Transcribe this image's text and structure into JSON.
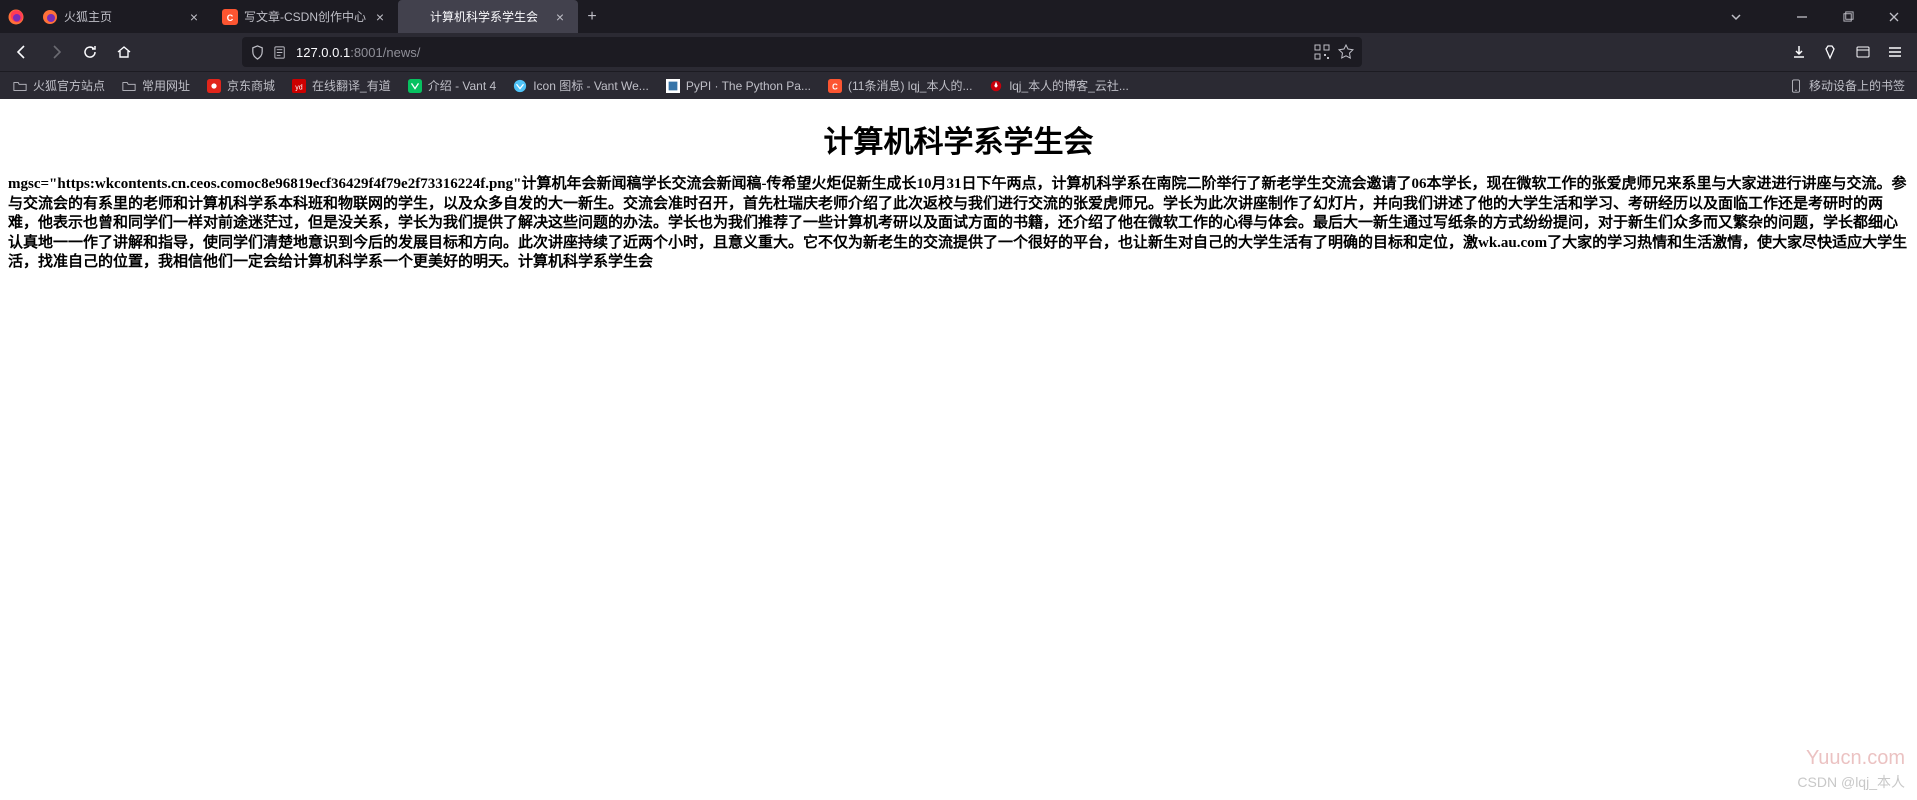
{
  "tabs": [
    {
      "label": "火狐主页",
      "favicon": "firefox"
    },
    {
      "label": "写文章-CSDN创作中心",
      "favicon": "csdn"
    },
    {
      "label": "计算机科学系学生会",
      "favicon": "none",
      "active": true
    }
  ],
  "url": {
    "host": "127.0.0.1",
    "port": ":8001",
    "path": "/news/"
  },
  "bookmarks": [
    {
      "label": "火狐官方站点",
      "icon": "folder"
    },
    {
      "label": "常用网址",
      "icon": "folder"
    },
    {
      "label": "京东商城",
      "icon": "jd"
    },
    {
      "label": "在线翻译_有道",
      "icon": "yd"
    },
    {
      "label": "介绍 - Vant 4",
      "icon": "vant"
    },
    {
      "label": "Icon 图标 - Vant We...",
      "icon": "vant2"
    },
    {
      "label": "PyPI · The Python Pa...",
      "icon": "pypi"
    },
    {
      "label": "(11条消息) lqj_本人的...",
      "icon": "csdn"
    },
    {
      "label": "lqj_本人的博客_云社...",
      "icon": "hw"
    }
  ],
  "bookmark_right": "移动设备上的书签",
  "page": {
    "title": "计算机科学系学生会",
    "body": "mgsc=\"https:wkcontents.cn.ceos.comoc8e96819ecf36429f4f79e2f73316224f.png\"计算机年会新闻稿学长交流会新闻稿-传希望火炬促新生成长10月31日下午两点，计算机科学系在南院二阶举行了新老学生交流会邀请了06本学长，现在微软工作的张爱虎师兄来系里与大家进进行讲座与交流。参与交流会的有系里的老师和计算机科学系本科班和物联网的学生，以及众多自发的大一新生。交流会准时召开，首先杜瑞庆老师介绍了此次返校与我们进行交流的张爱虎师兄。学长为此次讲座制作了幻灯片，并向我们讲述了他的大学生活和学习、考研经历以及面临工作还是考研时的两难，他表示也曾和同学们一样对前途迷茫过，但是没关系，学长为我们提供了解决这些问题的办法。学长也为我们推荐了一些计算机考研以及面试方面的书籍，还介绍了他在微软工作的心得与体会。最后大一新生通过写纸条的方式纷纷提问，对于新生们众多而又繁杂的问题，学长都细心认真地一一作了讲解和指导，使同学们清楚地意识到今后的发展目标和方向。此次讲座持续了近两个小时，且意义重大。它不仅为新老生的交流提供了一个很好的平台，也让新生对自己的大学生活有了明确的目标和定位，激wk.au.com了大家的学习热情和生活激情，使大家尽快适应大学生活，找准自己的位置，我相信他们一定会给计算机科学系一个更美好的明天。计算机科学系学生会"
  },
  "watermark1": "Yuucn.com",
  "watermark2": "CSDN @lqj_本人"
}
